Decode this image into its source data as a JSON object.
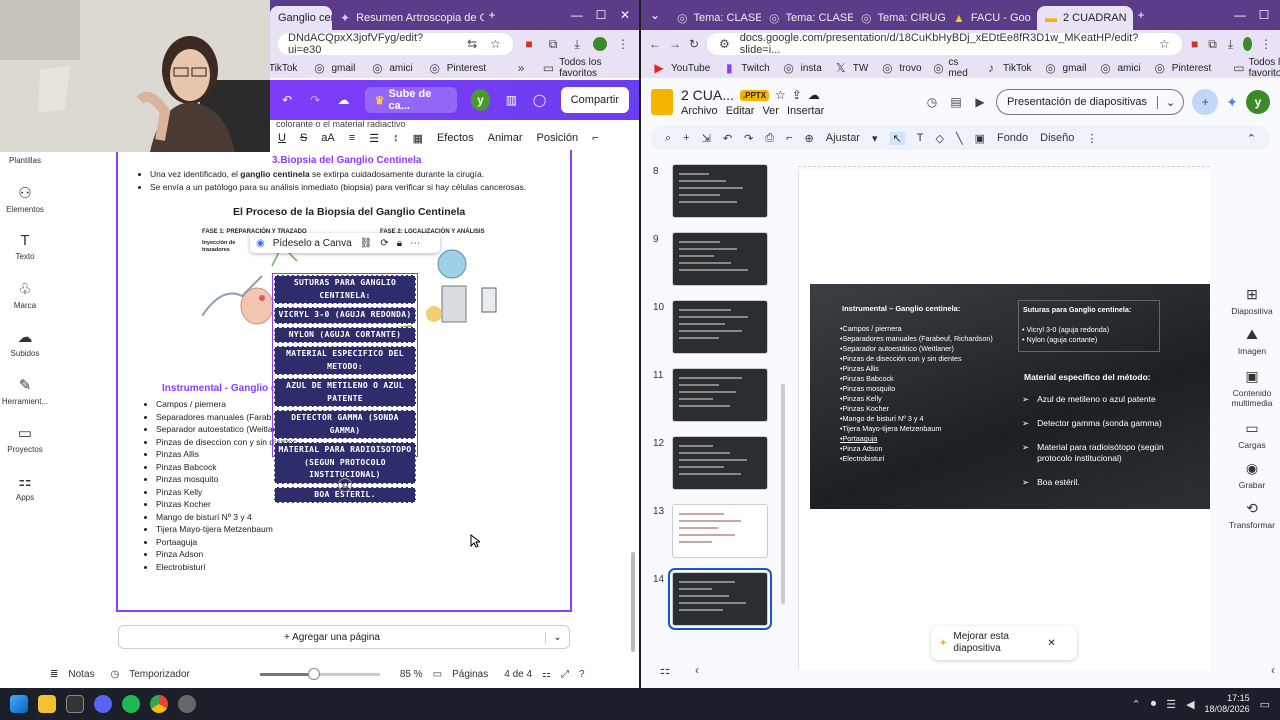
{
  "left_browser": {
    "tabs": [
      {
        "label": "Ganglio cen"
      },
      {
        "label": "Resumen Artroscopia de Cade"
      }
    ],
    "url": "DNdACQpxX3jofVFyg/edit?ui=e30",
    "bookmarks": [
      {
        "label": "TikTok"
      },
      {
        "label": "gmail"
      },
      {
        "label": "amici"
      },
      {
        "label": "Pinterest"
      },
      {
        "label": "Todos los favoritos"
      }
    ]
  },
  "canva": {
    "upgrade_label": "Sube de ca...",
    "avatar_initial": "y",
    "share_label": "Compartir",
    "cut_text": "colorante o el material radiactivo",
    "toolbar": {
      "font_size": "aA",
      "effects": "Efectos",
      "animate": "Animar",
      "position": "Posición"
    },
    "sidenav": [
      {
        "label": "Plantillas",
        "icon": "template-icon"
      },
      {
        "label": "Elementos",
        "icon": "elements-icon"
      },
      {
        "label": "Texto",
        "icon": "text-icon"
      },
      {
        "label": "Marca",
        "icon": "brand-icon"
      },
      {
        "label": "Subidos",
        "icon": "upload-icon"
      },
      {
        "label": "Herramient...",
        "icon": "tools-icon"
      },
      {
        "label": "Proyectos",
        "icon": "folder-icon"
      },
      {
        "label": "Apps",
        "icon": "apps-icon"
      }
    ],
    "doc": {
      "section3_title": "3.Biopsia del Ganglio Centinela",
      "bullet1_pre": "Una vez identificado, el ",
      "bullet1_bold": "ganglio centinela",
      "bullet1_post": " se extirpa cuidadosamente durante la cirugía.",
      "bullet2": "Se envía a un patólogo para su análisis inmediato (biopsia) para verificar si hay células cancerosas.",
      "infographic_title": "El Proceso de la Biopsia del Ganglio Centinela",
      "phase1": "FASE 1: PREPARACIÓN Y TRAZADO",
      "phase2": "FASE 2: LOCALIZACIÓN Y ANÁLISIS",
      "injection_label": "Inyección de trazadores",
      "instrumental_title": "Instrumental - Ganglio c",
      "instruments": [
        "Campos / piernera",
        "Separadores manuales (Farab",
        "Separador autoestatico (Weitlaner",
        "Pinzas de diseccion con y sin dientes",
        "Pinzas Allis",
        "Pinzas Babcock",
        "Pinzas mosquito",
        "Pinzas Kelly",
        "Pinzas Kocher",
        "Mango de bisturí Nº 3 y 4",
        "Tijera Mayo-tijera Metzenbaum",
        "Portaaguja",
        "Pinza Adson",
        "Electrobisturí"
      ]
    },
    "floatbar": {
      "label": "Pídeselo a Canva"
    },
    "overlay_lines": [
      "SUTURAS PARA GANGLIO CENTINELA:",
      "VICRYL 3-0 (AGUJA REDONDA)",
      "NYLON (AGUJA CORTANTE)",
      "MATERIAL ESPECIFICO DEL METODO:",
      "AZUL DE METILENO O AZUL PATENTE",
      "DETECTOR GAMMA (SONDA GAMMA)",
      "MATERIAL PARA RADIOISOTOPO (SEGUN PROTOCOLO INSTITUCIONAL)",
      "BOA ESTERIL."
    ],
    "add_page": "+ Agregar una página",
    "bottom": {
      "notes": "Notas",
      "timer": "Temporizador",
      "zoom": "85 %",
      "zoom_fraction": 0.45,
      "pages_label": "Páginas",
      "page_count": "4 de 4"
    }
  },
  "right_browser": {
    "tabs": [
      {
        "label": "Tema: CLASE"
      },
      {
        "label": "Tema: CLASE"
      },
      {
        "label": "Tema: CIRUG"
      },
      {
        "label": "FACU - Goo"
      },
      {
        "label": "2 CUADRAN"
      }
    ],
    "url": "docs.google.com/presentation/d/18CuKbHyBDj_xEDtEe8fR3D1w_MKeatHP/edit?slide=i...",
    "bookmarks": [
      {
        "label": "YouTube"
      },
      {
        "label": "Twitch"
      },
      {
        "label": "insta"
      },
      {
        "label": "TW"
      },
      {
        "label": "trovo"
      },
      {
        "label": "cs med"
      },
      {
        "label": "TikTok"
      },
      {
        "label": "gmail"
      },
      {
        "label": "amici"
      },
      {
        "label": "Pinterest"
      },
      {
        "label": "Todos los favoritos"
      }
    ]
  },
  "slides": {
    "doc_title": "2 CUA...",
    "badge": ".PPTX",
    "menus": [
      "Archivo",
      "Editar",
      "Ver",
      "Insertar"
    ],
    "present_label": "Presentación de diapositivas",
    "avatar_initial": "y",
    "toolbar": {
      "fit": "Ajustar",
      "background": "Fondo",
      "design": "Diseño"
    },
    "thumb_numbers": [
      "8",
      "9",
      "10",
      "11",
      "12",
      "13",
      "14"
    ],
    "side_tools": [
      {
        "label": "Diapositiva",
        "icon": "slide-icon"
      },
      {
        "label": "Imagen",
        "icon": "image-icon"
      },
      {
        "label": "Contenido multimedia",
        "icon": "media-icon"
      },
      {
        "label": "Cargas",
        "icon": "upload-icon"
      },
      {
        "label": "Grabar",
        "icon": "record-icon"
      },
      {
        "label": "Transformar",
        "icon": "transform-icon"
      }
    ],
    "slide": {
      "left_title": "Instrumental – Ganglio centinela:",
      "left_items": [
        "•Campos / piernera",
        "•Separadores manuales (Farabeuf, Richardson)",
        "•Separador autoestático (Weitlaner)",
        "•Pinzas de disección con y sin dientes",
        "•Pinzas Allis",
        "•Pinzas Babcock",
        "•Pinzas mosquito",
        "•Pinzas Kelly",
        "•Pinzas Kocher",
        "•Mango de bisturí Nº 3 y 4",
        "•Tijera Mayo-tijera Metzenbaum",
        "•Portaaguja",
        "•Pinza Adson",
        "•Electrobisturí"
      ],
      "sutures_title": "Suturas para Ganglio centinela:",
      "sutures": [
        "• Vicryl 3-0 (aguja redonda)",
        "• Nylon (aguja cortante)"
      ],
      "material_title": "Material específico del método:",
      "material_items": [
        "Azul de metileno o azul patente",
        "Detector gamma (sonda gamma)",
        "Material para radioisótopo (según protocolo institucional)",
        "Boa estéril."
      ]
    },
    "improve_label": "Mejorar esta diapositiva"
  },
  "taskbar": {
    "time": "17:15",
    "date": "18/08/2026"
  }
}
